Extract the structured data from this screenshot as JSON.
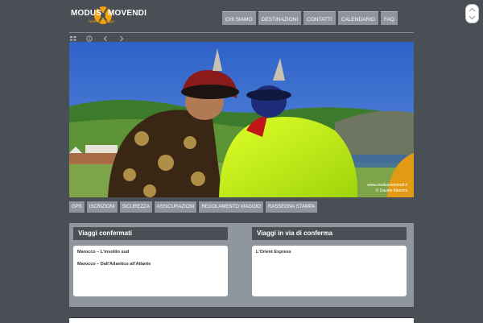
{
  "logo": {
    "word_left": "MODUS",
    "word_right": "MOVENDI",
    "tagline": "l'arte del viaggio"
  },
  "topnav": [
    {
      "label": "CHI SIAMO"
    },
    {
      "label": "DESTINAZIONI"
    },
    {
      "label": "CONTATTI"
    },
    {
      "label": "CALENDARIO"
    },
    {
      "label": "FAQ"
    }
  ],
  "controls": [
    "grid-icon",
    "info-icon",
    "prev-icon",
    "next-icon"
  ],
  "hero": {
    "credit_site": "www.modusmovendi.it",
    "credit_author": "© Davide Mancini"
  },
  "subnav": [
    {
      "label": "GPS"
    },
    {
      "label": "ISCRIZIONI"
    },
    {
      "label": "SICUREZZA"
    },
    {
      "label": "ASSICURAZIONI"
    },
    {
      "label": "REGOLAMENTO VIAGGIO"
    },
    {
      "label": "RASSEGNA STAMPA"
    }
  ],
  "confirmed": {
    "title": "Viaggi confermati",
    "trips": [
      "Marocco – L'insolito sud",
      "Marocco – Dall'Atlantico all'Atlante"
    ]
  },
  "pending": {
    "title": "Viaggi in via di conferma",
    "trips": [
      "L'Orient Express"
    ]
  },
  "colors": {
    "background": "#4a4f55",
    "button": "#8e959c",
    "accent": "#f2a20b",
    "panel": "#8f969c",
    "box_header": "#4b5057"
  }
}
